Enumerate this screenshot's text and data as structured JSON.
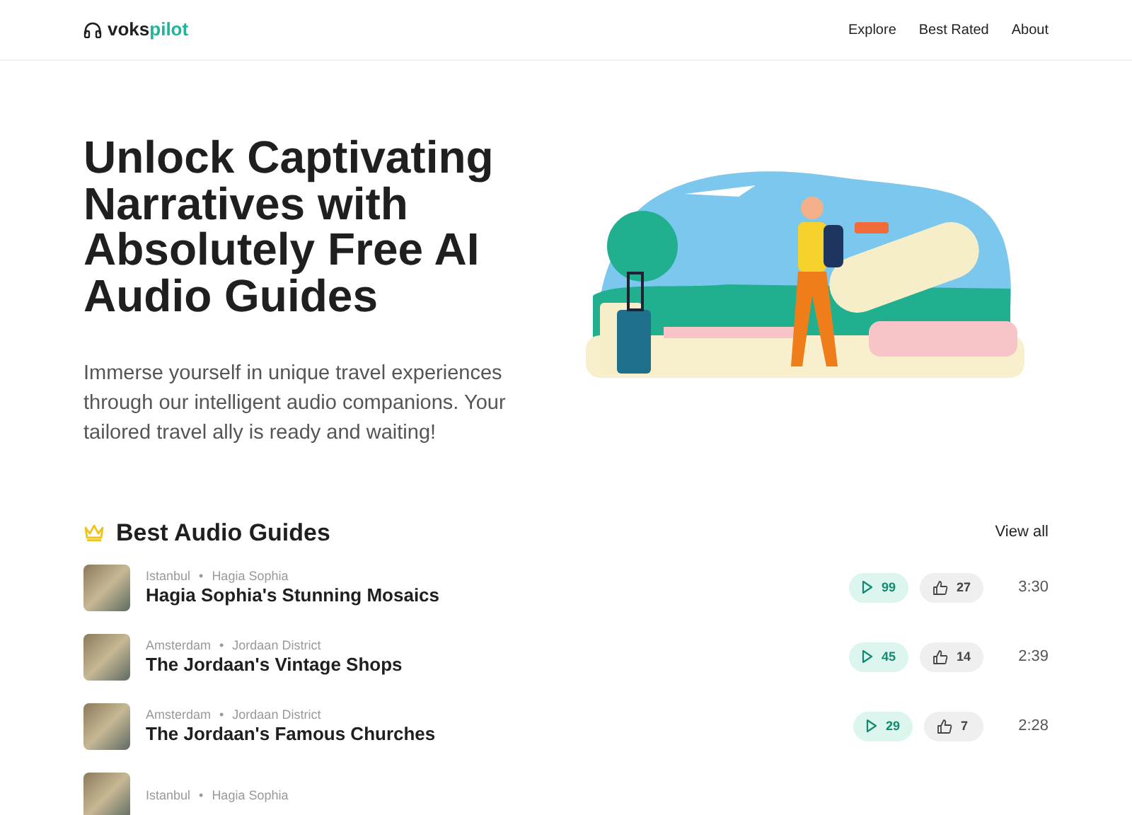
{
  "navbar": {
    "brand_prefix": "voks",
    "brand_suffix": "pilot",
    "links": [
      "Explore",
      "Best Rated",
      "About"
    ]
  },
  "hero": {
    "title": "Unlock Captivating Narratives with Absolutely Free AI Audio Guides",
    "subtitle": "Immerse yourself in unique travel experiences through our intelligent audio companions. Your tailored travel ally is ready and waiting!"
  },
  "section": {
    "title": "Best Audio Guides",
    "view_all": "View all",
    "separator": "•"
  },
  "guides": [
    {
      "city": "Istanbul",
      "place": "Hagia Sophia",
      "title": "Hagia Sophia's Stunning Mosaics",
      "plays": "99",
      "likes": "27",
      "duration": "3:30"
    },
    {
      "city": "Amsterdam",
      "place": "Jordaan District",
      "title": "The Jordaan's Vintage Shops",
      "plays": "45",
      "likes": "14",
      "duration": "2:39"
    },
    {
      "city": "Amsterdam",
      "place": "Jordaan District",
      "title": "The Jordaan's Famous Churches",
      "plays": "29",
      "likes": "7",
      "duration": "2:28"
    },
    {
      "city": "Istanbul",
      "place": "Hagia Sophia"
    }
  ]
}
